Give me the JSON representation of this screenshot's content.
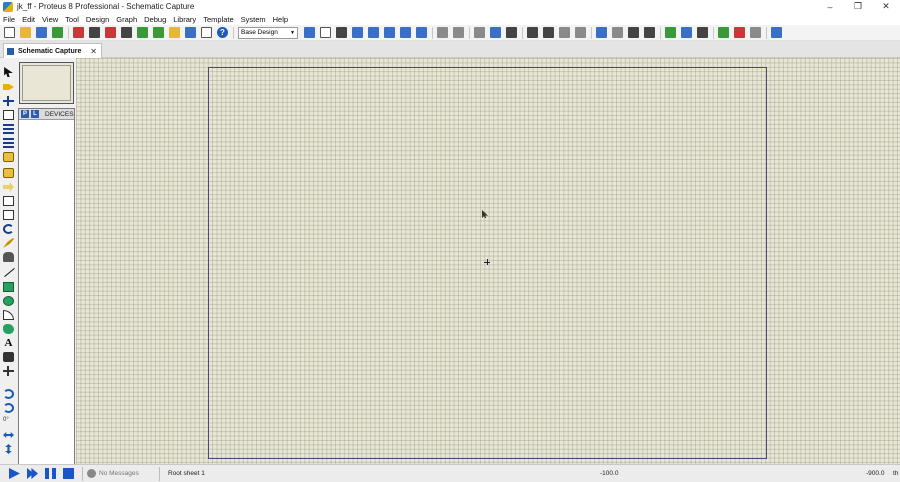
{
  "window": {
    "title": "jk_ff - Proteus 8 Professional - Schematic Capture",
    "minimize": "–",
    "maximize": "❐",
    "close": "✕"
  },
  "menu": [
    "File",
    "Edit",
    "View",
    "Tool",
    "Design",
    "Graph",
    "Debug",
    "Library",
    "Template",
    "System",
    "Help"
  ],
  "toolbar": {
    "layer_value": "Base Design",
    "help_glyph": "?"
  },
  "tabs": [
    {
      "label": "Schematic Capture",
      "close": "✕"
    }
  ],
  "device_panel": {
    "p_button": "P",
    "l_button": "L",
    "title": "DEVICES"
  },
  "left_tools": {
    "text_tool_glyph": "A",
    "angle_value": "0°"
  },
  "statusbar": {
    "messages": "No Messages",
    "sheet": "Root sheet 1",
    "coord_x": "-100.0",
    "coord_y": "-900.0",
    "unit": "th"
  },
  "colors": {
    "canvas": "#e8e6d4",
    "sheet_border": "#4a4a78",
    "accent": "#1a55c8"
  }
}
